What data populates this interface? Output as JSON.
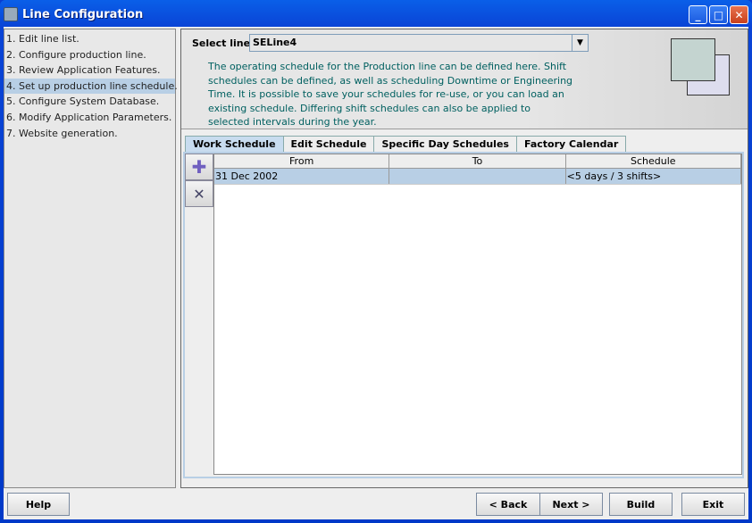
{
  "window": {
    "title": "Line Configuration"
  },
  "steps": [
    "1. Edit line list.",
    "2. Configure production line.",
    "3. Review Application Features.",
    "4. Set up production line schedule.",
    "5. Configure System Database.",
    "6. Modify Application Parameters.",
    "7. Website generation."
  ],
  "selected_step": 3,
  "header": {
    "select_label": "Select line:",
    "select_value": "SELine4",
    "description": "The operating schedule for the Production line can be defined here. Shift schedules can be defined, as well as scheduling Downtime or Engineering Time. It is possible to save your schedules for re-use, or you can load an existing schedule. Differing shift schedules can also be applied to selected intervals during the year."
  },
  "tabs": [
    "Work Schedule",
    "Edit Schedule",
    "Specific Day Schedules",
    "Factory Calendar"
  ],
  "table": {
    "columns": [
      "From",
      "To",
      "Schedule"
    ],
    "rows": [
      [
        "31 Dec 2002",
        "",
        "<5 days / 3 shifts>"
      ]
    ]
  },
  "buttons": {
    "help": "Help",
    "back": "< Back",
    "next": "Next >",
    "build": "Build",
    "exit": "Exit"
  }
}
